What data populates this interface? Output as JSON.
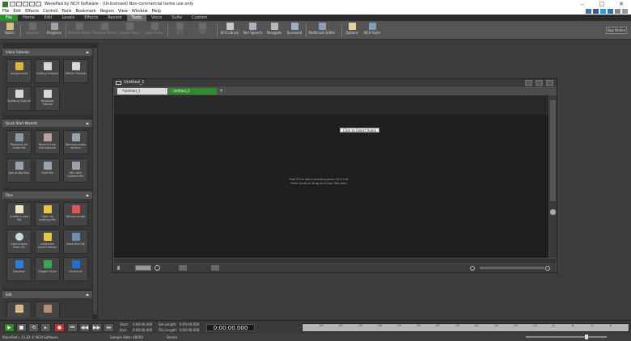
{
  "window": {
    "title": "WavePad by NCH Software - (Unlicensed) Non-commercial home use only"
  },
  "menu": [
    "File",
    "Edit",
    "Effects",
    "Control",
    "Tools",
    "Bookmark",
    "Region",
    "View",
    "Window",
    "Help"
  ],
  "tabs": [
    {
      "label": "File"
    },
    {
      "label": "Home"
    },
    {
      "label": "Edit"
    },
    {
      "label": "Levels"
    },
    {
      "label": "Effects"
    },
    {
      "label": "Record"
    },
    {
      "label": "Tools"
    },
    {
      "label": "Voice"
    },
    {
      "label": "Suite"
    },
    {
      "label": "Custom"
    }
  ],
  "ribbon": [
    {
      "label": "Batch",
      "enabled": true
    },
    {
      "label": "Regions",
      "enabled": false
    },
    {
      "label": "Ringtone",
      "enabled": true
    },
    {
      "label": "Remove Noise",
      "enabled": false
    },
    {
      "label": "Remove Voice",
      "enabled": false
    },
    {
      "label": "Isolate Voice",
      "enabled": false
    },
    {
      "label": "Fade Finder",
      "enabled": false
    },
    {
      "label": "FFT",
      "enabled": false
    },
    {
      "label": "TFFT",
      "enabled": false
    },
    {
      "label": "SFX Library",
      "enabled": true
    },
    {
      "label": "Text Speech",
      "enabled": true
    },
    {
      "label": "Navigate",
      "enabled": true
    },
    {
      "label": "Surround",
      "enabled": true
    },
    {
      "label": "Multitrack Editor",
      "enabled": true
    },
    {
      "label": "Options",
      "enabled": true
    },
    {
      "label": "NCH Suite",
      "enabled": true
    }
  ],
  "buy_online": "Buy Online",
  "panels": [
    {
      "title": "Video Tutorials",
      "items": [
        "Introduction",
        "Editing Tutorial",
        "Effects Tutorial",
        "Splitting Tutorial",
        "Ringtone Tutorial"
      ]
    },
    {
      "title": "Quick Start Wizards",
      "items": [
        "Playback an audio file",
        "Record from microphone",
        "Remove audio section",
        "Join audio files",
        "Split file",
        "Mix with another file"
      ]
    },
    {
      "title": "Files",
      "items": [
        "Create a new file",
        "Open an existing file",
        "Record audio",
        "Load tracks from CD",
        "Load from sound library",
        "Save this file",
        "Dropbox",
        "Google Drive",
        "OneDrive"
      ]
    },
    {
      "title": "Edit",
      "items": [
        "",
        ""
      ]
    }
  ],
  "document": {
    "title": "Untitled_1",
    "tabs": [
      "*Untitled_1",
      "Untitled_2"
    ],
    "tooltip": "Click to Select Audio",
    "hint": "Push F5 to start recording press Ctrl+V to Paste Audio or Drag and Drop files here"
  },
  "transport": {
    "start_label": "Start:",
    "start": "0:00:00.000",
    "end_label": "End:",
    "end": "0:00:00.000",
    "sel_label": "Sel Length:",
    "sel": "0:00:00.000",
    "file_label": "File Length:",
    "file": "0:00:00.000",
    "timecode": "0:00:00.000",
    "level_ticks": [
      "-45",
      "-42",
      "-39",
      "-36",
      "-33",
      "-30",
      "-27",
      "-24",
      "-21",
      "-18",
      "-15",
      "-12",
      "-9",
      "-6",
      "-3",
      "0"
    ]
  },
  "status": {
    "version": "WavePad v 15.81 © NCH Software",
    "sample_rate": "Sample Rate: 48000",
    "stereo": "Stereo"
  },
  "colors": {
    "accent_green": "#2e8b2e",
    "record_red": "#c63030"
  }
}
